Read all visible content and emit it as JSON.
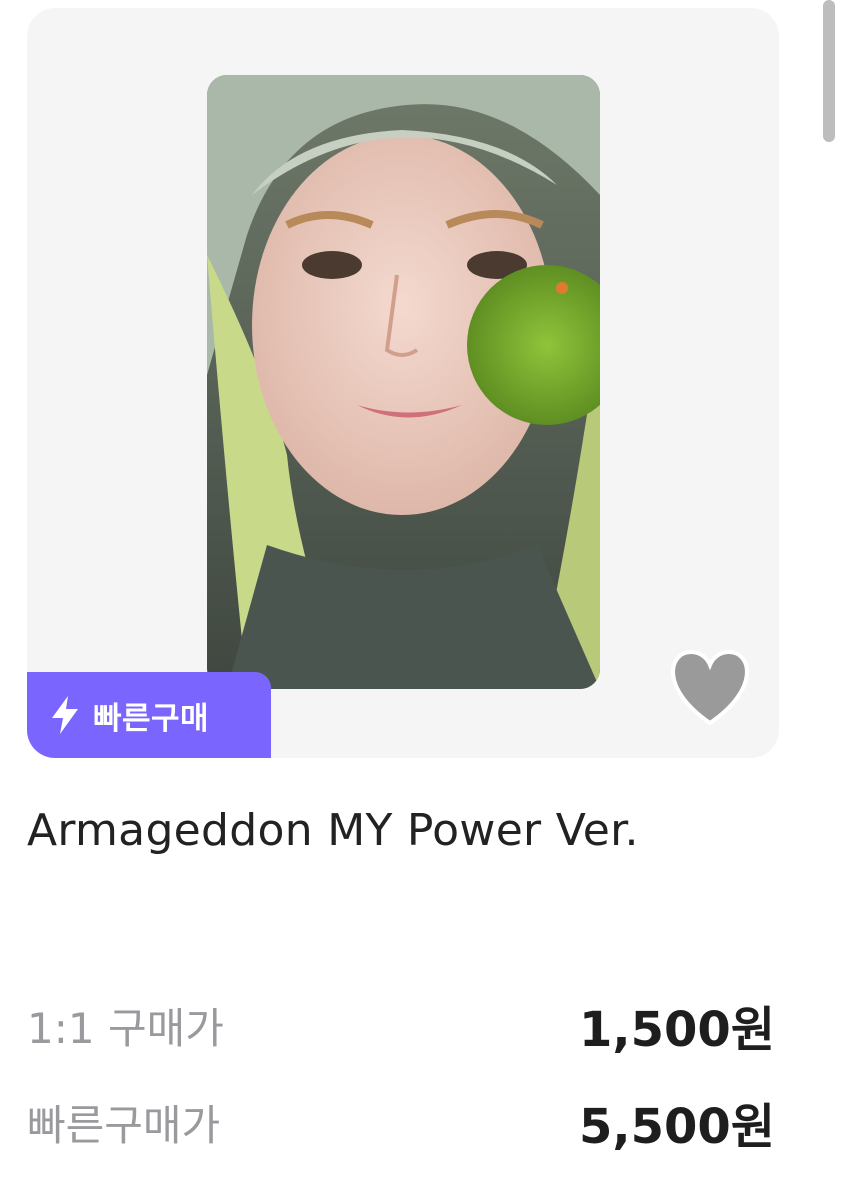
{
  "product": {
    "title": "Armageddon MY Power Ver.",
    "badge_label": "빠른구매",
    "badge_icon": "lightning-bolt-icon",
    "wishlist_icon": "heart-icon"
  },
  "prices": [
    {
      "label": "1:1 구매가",
      "value": "1,500원"
    },
    {
      "label": "빠른구매가",
      "value": "5,500원"
    }
  ],
  "colors": {
    "accent": "#7a66ff",
    "card_bg": "#f5f5f6",
    "heart": "#9a9a9a"
  }
}
